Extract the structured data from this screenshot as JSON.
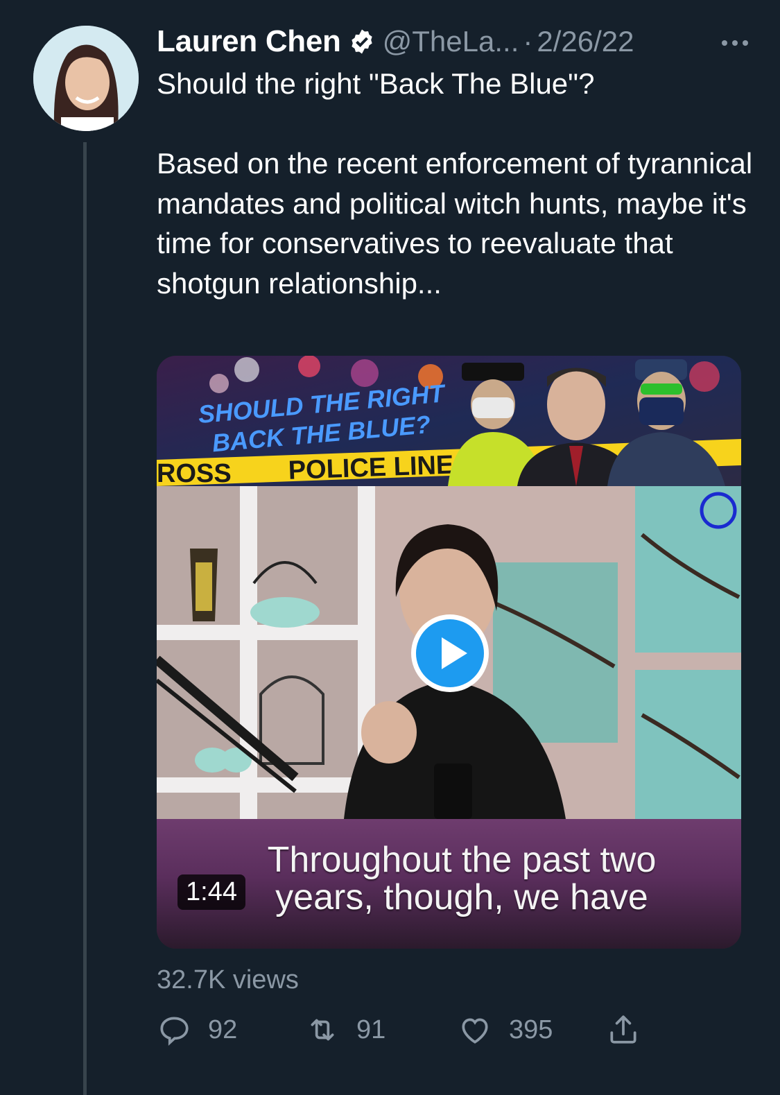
{
  "tweet": {
    "author_name": "Lauren Chen",
    "handle": "@TheLa...",
    "separator": "·",
    "date": "2/26/22",
    "text": "Should the right \"Back The Blue\"?\n\nBased on the recent enforcement of tyrannical mandates and political witch hunts, maybe it's time for conservatives to reevaluate that shotgun relationship...",
    "verified": true
  },
  "media": {
    "banner_title_line1": "SHOULD THE RIGHT",
    "banner_title_line2": "BACK THE BLUE?",
    "tape_text_left": "ROSS",
    "tape_text_right": "POLICE LINE D",
    "caption": "Throughout the past two\nyears, though, we have",
    "duration": "1:44"
  },
  "stats": {
    "views": "32.7K views",
    "replies": "92",
    "retweets": "91",
    "likes": "395"
  },
  "icons": {
    "reply": "reply-icon",
    "retweet": "retweet-icon",
    "like": "heart-icon",
    "share": "share-icon",
    "more": "more-icon",
    "verified": "verified-badge-icon",
    "play": "play-icon"
  },
  "colors": {
    "background": "#15202b",
    "secondary_text": "#8b98a5",
    "accent": "#1d9bf0"
  }
}
